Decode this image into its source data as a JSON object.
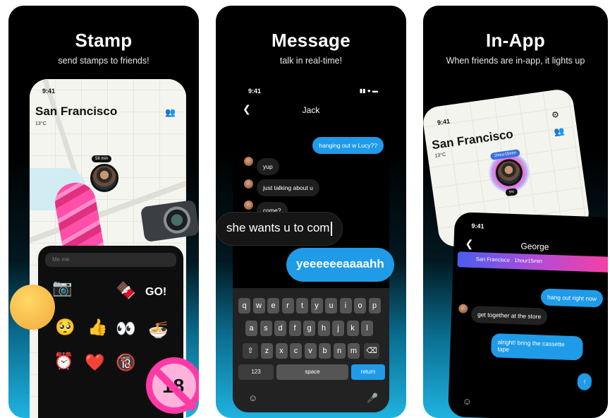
{
  "panels": {
    "stamp": {
      "title": "Stamp",
      "subtitle": "send stamps to friends!"
    },
    "message": {
      "title": "Message",
      "subtitle": "talk in real-time!"
    },
    "inapp": {
      "title": "In-App",
      "subtitle": "When friends are in-app, it lights up"
    }
  },
  "stamp_phone": {
    "time": "9:41",
    "city": "San Francisco",
    "temperature": "13°C",
    "distance_pill": "58 min",
    "search_placeholder": "Me         me",
    "stickers": [
      "📷",
      "🍫",
      "GO!",
      "🥺",
      "👍",
      "👀",
      "🍜",
      "⏰",
      "❤️",
      "🔞"
    ],
    "no_sign_text": "18"
  },
  "message_phone": {
    "time": "9:41",
    "contact": "Jack",
    "messages": [
      {
        "text": "hanging out w Lucy??",
        "dir": "out"
      },
      {
        "text": "yup",
        "dir": "in"
      },
      {
        "text": "just talking about u",
        "dir": "in"
      },
      {
        "text": "come?",
        "dir": "in"
      }
    ],
    "typing": "she wants u to com",
    "sending": "yeeeeeeaaaahh",
    "keyboard": {
      "row1": [
        "q",
        "w",
        "e",
        "r",
        "t",
        "y",
        "u",
        "i",
        "o",
        "p"
      ],
      "row2": [
        "a",
        "s",
        "d",
        "f",
        "g",
        "h",
        "j",
        "k",
        "l"
      ],
      "row3": [
        "z",
        "x",
        "c",
        "v",
        "b",
        "n",
        "m"
      ],
      "shift": "⇧",
      "delete": "⌫",
      "numbers": "123",
      "space": "space",
      "return": "return"
    }
  },
  "inapp_phone": {
    "time": "9:41",
    "city": "San Francisco",
    "temperature": "13°C",
    "glow_pill": "1hour15min",
    "glow_sub": "5%",
    "chat": {
      "time": "9:41",
      "contact": "George",
      "location_banner": "San Francisco · 1hour15min",
      "messages": [
        {
          "text": "hang out right now",
          "dir": "out"
        },
        {
          "text": "get together at the store",
          "dir": "in"
        },
        {
          "text": "alright! bring the cassette\ntape",
          "dir": "out"
        },
        {
          "text": "!",
          "dir": "out"
        }
      ]
    }
  },
  "icons": {
    "add_friend": "add-friend-icon",
    "settings": "gear-icon",
    "back": "chevron-left-icon",
    "emoji": "emoji-icon",
    "mic": "microphone-icon"
  },
  "colors": {
    "accent_blue": "#1f9be8",
    "pink": "#ff3aa5",
    "teal": "#1fb3e0"
  }
}
